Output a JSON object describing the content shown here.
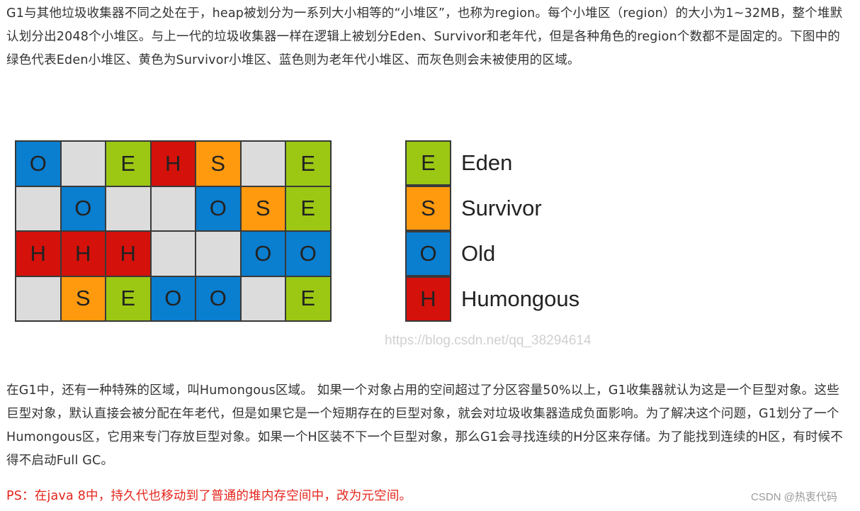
{
  "paragraphs": {
    "intro": "G1与其他垃圾收集器不同之处在于，heap被划分为一系列大小相等的“小堆区”，也称为region。每个小堆区（region）的大小为1~32MB，整个堆默认划分出2048个小堆区。与上一代的垃圾收集器一样在逻辑上被划分Eden、Survivor和老年代，但是各种角色的region个数都不是固定的。下图中的绿色代表Eden小堆区、黄色为Survivor小堆区、蓝色则为老年代小堆区、而灰色则会未被使用的区域。",
    "humongous": "在G1中，还有一种特殊的区域，叫Humongous区域。 如果一个对象占用的空间超过了分区容量50%以上，G1收集器就认为这是一个巨型对象。这些巨型对象，默认直接会被分配在年老代，但是如果它是一个短期存在的巨型对象，就会对垃圾收集器造成负面影响。为了解决这个问题，G1划分了一个Humongous区，它用来专门存放巨型对象。如果一个H区装不下一个巨型对象，那么G1会寻找连续的H分区来存储。为了能找到连续的H区，有时候不得不启动Full GC。",
    "ps": "PS：在java 8中，持久代也移动到了普通的堆内存空间中，改为元空间。"
  },
  "colors": {
    "E": "#9cc814",
    "S": "#ff9a0e",
    "O": "#0a7ecf",
    "H": "#d4110a",
    "empty": "#dcdcdc"
  },
  "grid": {
    "rows": [
      [
        "O",
        "",
        "E",
        "H",
        "S",
        "",
        "E"
      ],
      [
        "",
        "O",
        "",
        "",
        "O",
        "S",
        "E"
      ],
      [
        "H",
        "H",
        "H",
        "",
        "",
        "O",
        "O"
      ],
      [
        "",
        "S",
        "E",
        "O",
        "O",
        "",
        "E"
      ]
    ]
  },
  "legend": [
    {
      "key": "E",
      "label": "Eden"
    },
    {
      "key": "S",
      "label": "Survivor"
    },
    {
      "key": "O",
      "label": "Old"
    },
    {
      "key": "H",
      "label": "Humongous"
    }
  ],
  "watermark": "https://blog.csdn.net/qq_38294614",
  "csdn_mark": "CSDN @热衷代码"
}
